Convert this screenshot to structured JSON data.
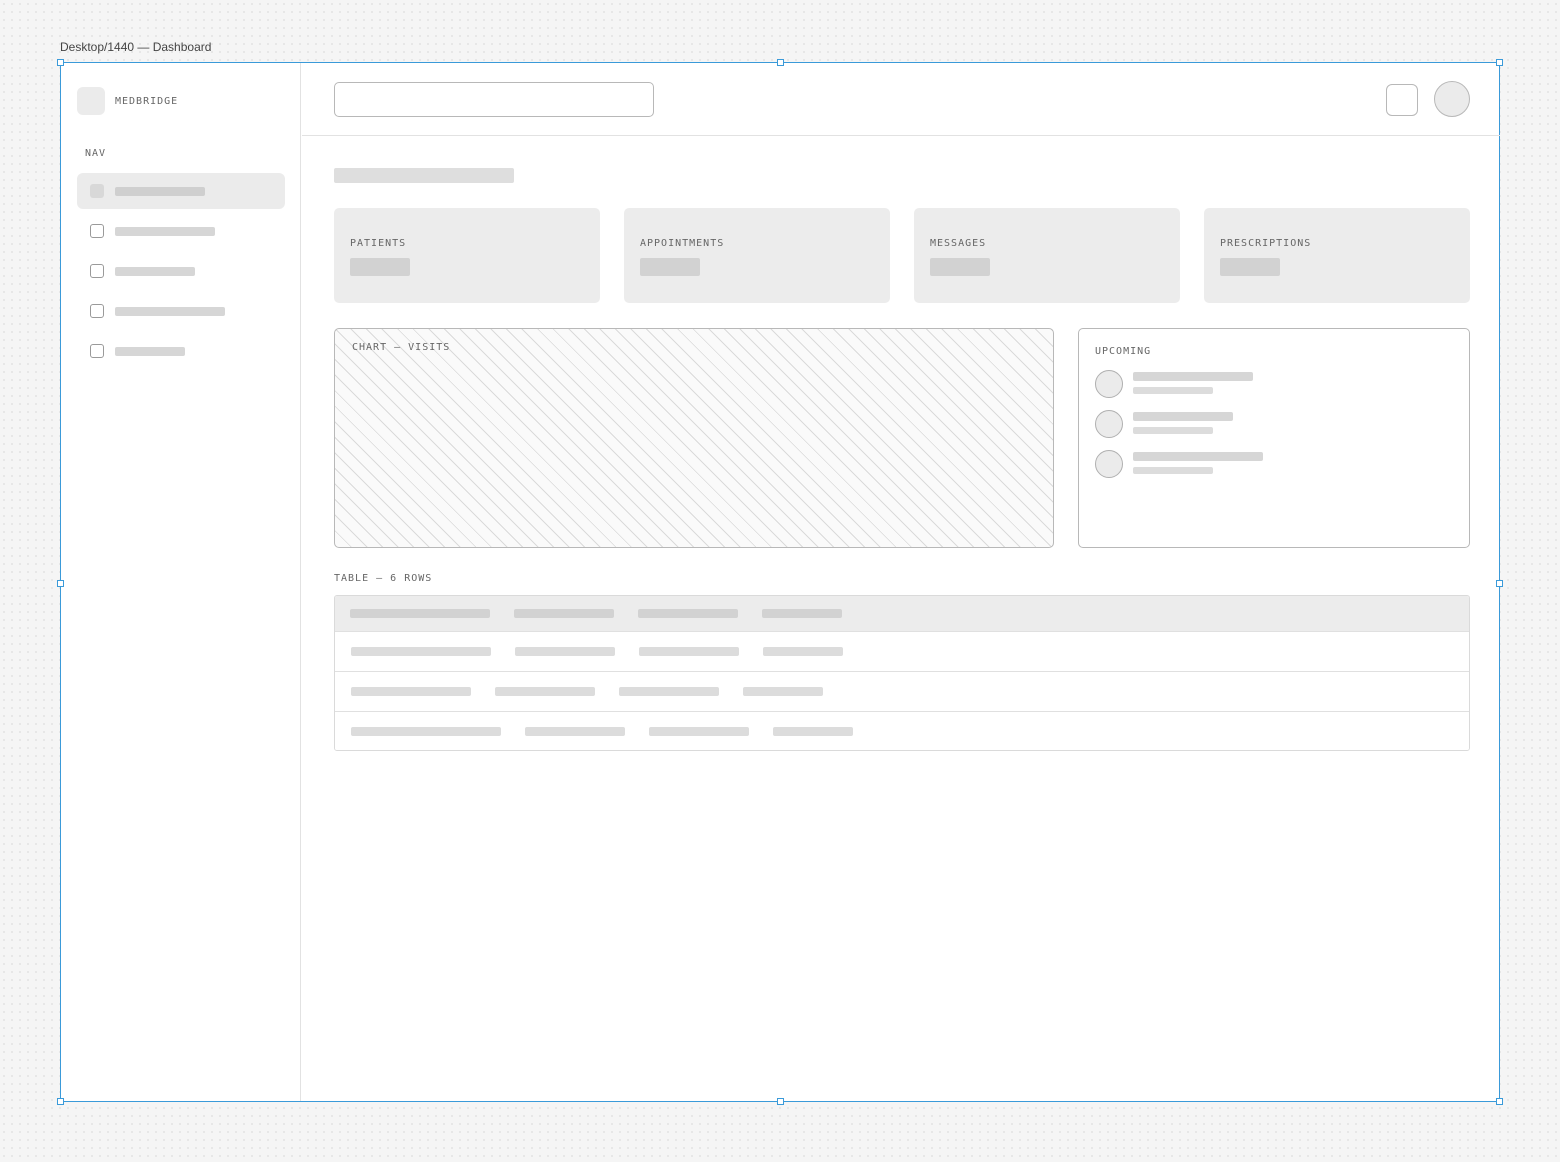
{
  "canvas": {
    "frame_label": "Desktop/1440 — Dashboard"
  },
  "sidebar": {
    "brand": "MEDBRIDGE",
    "nav_label": "NAV",
    "active_index": 0
  },
  "topbar": {
    "search_placeholder": ""
  },
  "stats": [
    {
      "label": "PATIENTS"
    },
    {
      "label": "APPOINTMENTS"
    },
    {
      "label": "MESSAGES"
    },
    {
      "label": "PRESCRIPTIONS"
    }
  ],
  "chart": {
    "label": "CHART — VISITS"
  },
  "upcoming": {
    "label": "UPCOMING"
  },
  "table": {
    "label": "TABLE — 6 ROWS"
  },
  "colors": {
    "selection": "#3a9ad9",
    "placeholder": "#d6d6d6",
    "card": "#ececec"
  }
}
